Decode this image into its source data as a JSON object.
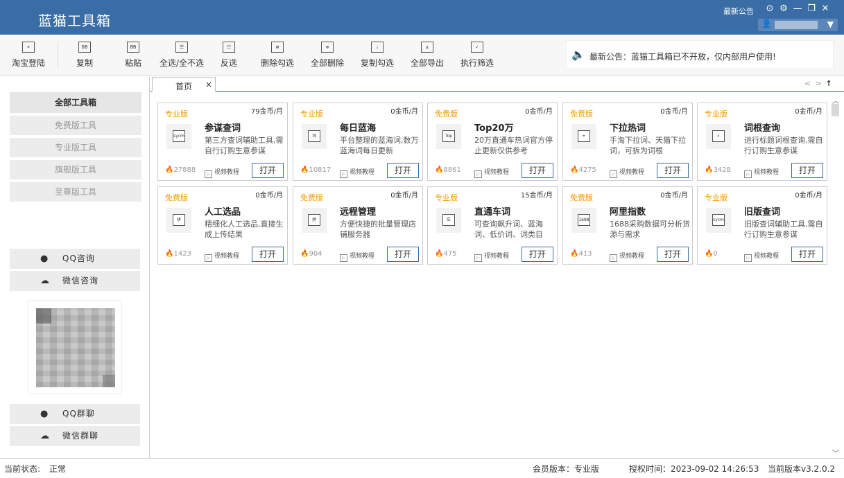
{
  "app": {
    "title": "蓝猫工具箱",
    "title_notice": "最新公告",
    "window_controls": [
      "⊙",
      "⚙",
      "—",
      "❐",
      "✕"
    ],
    "user_caret": "▼",
    "user_icon": "person-icon"
  },
  "toolbar": {
    "items": [
      {
        "label": "淘宝登陆",
        "icon": "⌖",
        "icon_name": "taobao-login-icon"
      },
      {
        "label": "复制",
        "icon": "DB",
        "icon_name": "copy-icon"
      },
      {
        "label": "粘贴",
        "icon": "BB",
        "icon_name": "paste-icon"
      },
      {
        "label": "全选/全不选",
        "icon": "☰",
        "icon_name": "select-all-icon"
      },
      {
        "label": "反选",
        "icon": "☷",
        "icon_name": "invert-select-icon"
      },
      {
        "label": "删除勾选",
        "icon": "⊠",
        "icon_name": "delete-checked-icon"
      },
      {
        "label": "全部删除",
        "icon": "⊗",
        "icon_name": "delete-all-icon"
      },
      {
        "label": "复制勾选",
        "icon": "⇣",
        "icon_name": "copy-checked-icon"
      },
      {
        "label": "全部导出",
        "icon": "⇊",
        "icon_name": "export-all-icon"
      },
      {
        "label": "执行筛选",
        "icon": "✓",
        "icon_name": "run-filter-icon"
      }
    ],
    "announcement": "最新公告：蓝猫工具箱已不开放，仅内部用户使用!"
  },
  "sidebar": {
    "categories": [
      "全部工具箱",
      "免费版工具",
      "专业版工具",
      "旗舰版工具",
      "至尊版工具"
    ],
    "contacts": [
      {
        "label": "QQ咨询",
        "icon": "🔔"
      },
      {
        "label": "微信咨询",
        "icon": "☁"
      },
      {
        "label": "QQ群聊",
        "icon": "🔔"
      },
      {
        "label": "微信群聊",
        "icon": "☁"
      }
    ]
  },
  "tabs": [
    {
      "label": "首页",
      "close": "×"
    }
  ],
  "nav": {
    "prev": "<",
    "next": ">",
    "top": "↑"
  },
  "scroll": {
    "up": "︿",
    "down": "﹀"
  },
  "tools": [
    {
      "edition": "专业版",
      "price": "79金币/月",
      "icon": "sycm",
      "name": "参谋查词",
      "desc": "第三方查词辅助工具,需自行订购生意参谋",
      "heat": "27888",
      "video": "视频教程",
      "open": "打开"
    },
    {
      "edition": "专业版",
      "price": "0金币/月",
      "icon": "词",
      "name": "每日蓝海",
      "desc": "平台整理的蓝海词,数万蓝海词每日更新",
      "heat": "10817",
      "video": "视频教程",
      "open": "打开"
    },
    {
      "edition": "免费版",
      "price": "0金币/月",
      "icon": "Top",
      "name": "Top20万",
      "desc": "20万直通车热词官方停止更新仅供参考",
      "heat": "8861",
      "video": "视频教程",
      "open": "打开"
    },
    {
      "edition": "免费版",
      "price": "0金币/月",
      "icon": "⌖",
      "name": "下拉热词",
      "desc": "手淘下拉词、天猫下拉词，可拆为词根",
      "heat": "4275",
      "video": "视频教程",
      "open": "打开"
    },
    {
      "edition": "专业版",
      "price": "0金币/月",
      "icon": "⌕",
      "name": "词根查询",
      "desc": "进行标题词根查询,需自行订购生意参谋",
      "heat": "3428",
      "video": "视频教程",
      "open": "打开"
    },
    {
      "edition": "免费版",
      "price": "0金币/月",
      "icon": "拼",
      "name": "人工选品",
      "desc": "精细化人工选品,直接生成上传结果",
      "heat": "1423",
      "video": "视频教程",
      "open": "打开"
    },
    {
      "edition": "免费版",
      "price": "0金币/月",
      "icon": "拼",
      "name": "远程管理",
      "desc": "方便快捷的批量管理店铺服务器",
      "heat": "904",
      "video": "视频教程",
      "open": "打开"
    },
    {
      "edition": "专业版",
      "price": "15金币/月",
      "icon": "车",
      "name": "直通车词",
      "desc": "可查询飙升词、蓝海词、低价词、词类目",
      "heat": "475",
      "video": "视频教程",
      "open": "打开"
    },
    {
      "edition": "免费版",
      "price": "0金币/月",
      "icon": "1688",
      "name": "阿里指数",
      "desc": "1688采购数据可分析货源与需求",
      "heat": "413",
      "video": "视频教程",
      "open": "打开"
    },
    {
      "edition": "专业版",
      "price": "0金币/月",
      "icon": "sycm",
      "name": "旧版查词",
      "desc": "旧版查词辅助工具,需自行订购生意参谋",
      "heat": "0",
      "video": "视频教程",
      "open": "打开"
    }
  ],
  "status": {
    "state_label": "当前状态:",
    "state_value": "正常",
    "member": "会员版本：专业版",
    "auth": "授权时间：2023-09-02 14:26:53",
    "version": "当前版本v3.2.0.2"
  },
  "colors": {
    "titlebar": "#3a6da6",
    "edition": "#f39c12"
  }
}
